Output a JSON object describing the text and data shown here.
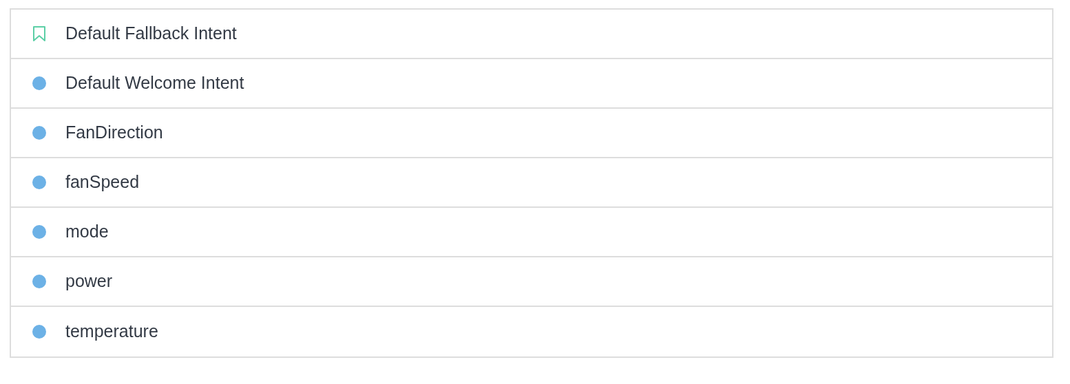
{
  "intents": [
    {
      "name": "Default Fallback Intent",
      "kind": "fallback"
    },
    {
      "name": "Default Welcome Intent",
      "kind": "intent"
    },
    {
      "name": "FanDirection",
      "kind": "intent"
    },
    {
      "name": "fanSpeed",
      "kind": "intent"
    },
    {
      "name": "mode",
      "kind": "intent"
    },
    {
      "name": "power",
      "kind": "intent"
    },
    {
      "name": "temperature",
      "kind": "intent"
    }
  ]
}
